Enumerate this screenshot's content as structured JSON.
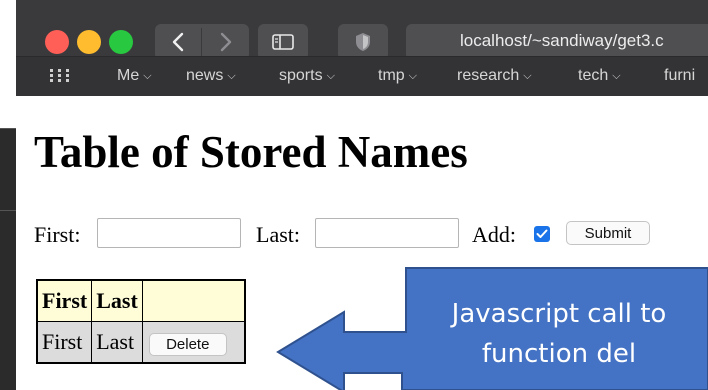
{
  "browser": {
    "url": "localhost/~sandiway/get3.c",
    "bookmarks": [
      {
        "label": "Me"
      },
      {
        "label": "news"
      },
      {
        "label": "sports"
      },
      {
        "label": "tmp"
      },
      {
        "label": "research"
      },
      {
        "label": "tech"
      },
      {
        "label": "furni"
      }
    ]
  },
  "page": {
    "title": "Table of Stored Names",
    "form": {
      "first_label": "First:",
      "first_value": "",
      "last_label": "Last:",
      "last_value": "",
      "add_label": "Add:",
      "add_checked": true,
      "submit_label": "Submit"
    },
    "table": {
      "headers": [
        "First",
        "Last",
        ""
      ],
      "rows": [
        {
          "first": "First",
          "last": "Last",
          "action": "Delete"
        }
      ]
    }
  },
  "annotation": {
    "line1": "Javascript call to",
    "line2": "function del",
    "fill_color": "#4472c4"
  },
  "colors": {
    "titlebar": "#3a3a3c",
    "header_cell": "#fffdd8",
    "data_cell": "#dcdcdc",
    "checkbox": "#1a73e8"
  }
}
